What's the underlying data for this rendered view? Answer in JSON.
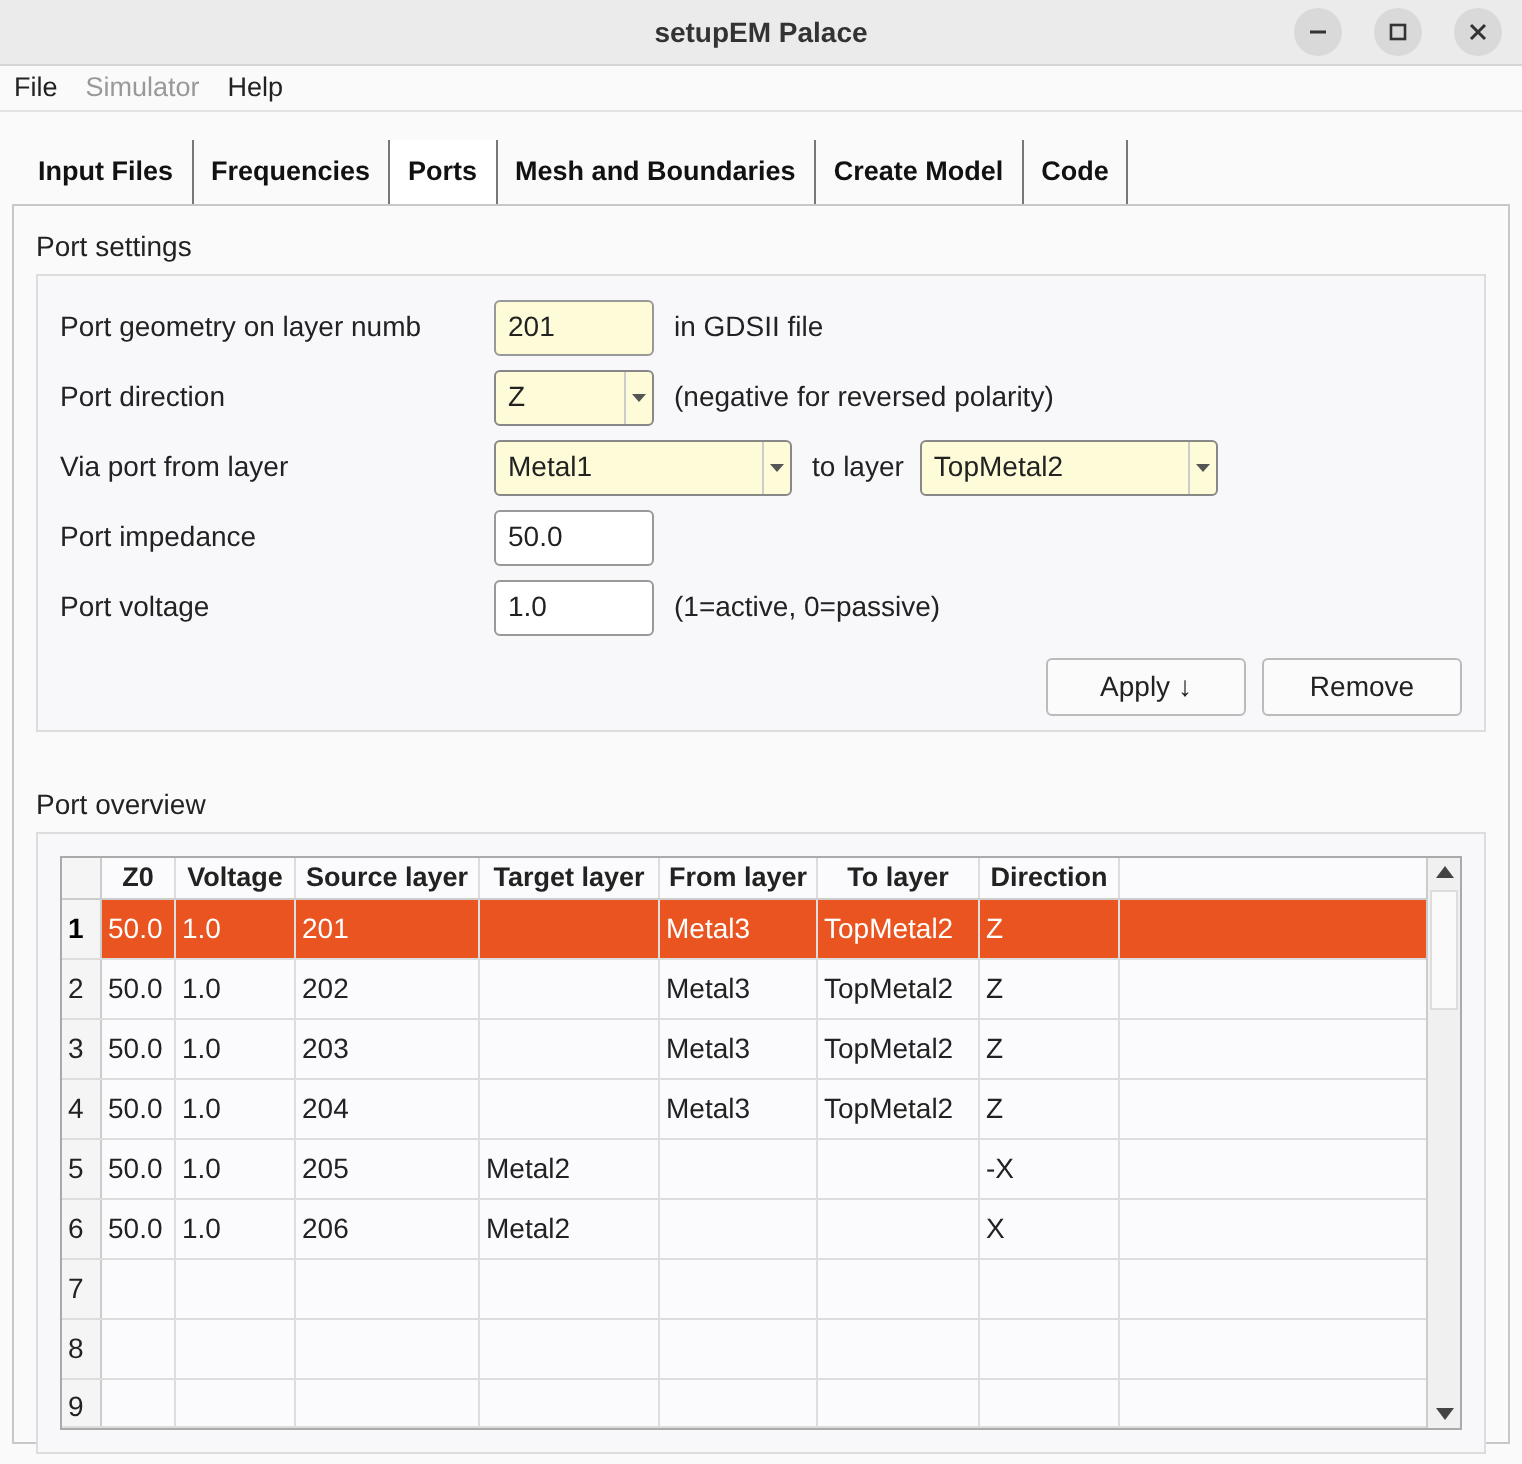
{
  "window": {
    "title": "setupEM Palace"
  },
  "menu": [
    {
      "label": "File",
      "disabled": false
    },
    {
      "label": "Simulator",
      "disabled": true
    },
    {
      "label": "Help",
      "disabled": false
    }
  ],
  "tabs": [
    {
      "label": "Input Files",
      "selected": false
    },
    {
      "label": "Frequencies",
      "selected": false
    },
    {
      "label": "Ports",
      "selected": true
    },
    {
      "label": "Mesh and Boundaries",
      "selected": false
    },
    {
      "label": "Create Model",
      "selected": false
    },
    {
      "label": "Code",
      "selected": false
    }
  ],
  "port_settings": {
    "title": "Port settings",
    "rows": [
      {
        "label": "Port geometry on layer numb",
        "controls": [
          {
            "kind": "field",
            "value": "201",
            "highlighted": true
          }
        ],
        "note": "in GDSII file"
      },
      {
        "label": "Port direction",
        "controls": [
          {
            "kind": "combo",
            "value": "Z",
            "highlighted": true
          }
        ],
        "note": "(negative for reversed polarity)"
      },
      {
        "label": "Via port from layer",
        "controls": [
          {
            "kind": "long_combo",
            "value": "Metal1",
            "highlighted": true
          },
          {
            "kind": "text",
            "value": "to layer"
          },
          {
            "kind": "long_combo",
            "value": "TopMetal2",
            "highlighted": true
          }
        ]
      },
      {
        "label": "Port impedance",
        "controls": [
          {
            "kind": "field",
            "value": "50.0",
            "highlighted": false
          }
        ]
      },
      {
        "label": "Port voltage",
        "controls": [
          {
            "kind": "field",
            "value": "1.0",
            "highlighted": false
          }
        ],
        "note": "(1=active, 0=passive)"
      }
    ],
    "buttons": [
      "Apply ↓",
      "Remove"
    ]
  },
  "port_overview": {
    "title": "Port overview",
    "columns": [
      "Z0",
      "Voltage",
      "Source layer",
      "Target layer",
      "From layer",
      "To layer",
      "Direction"
    ],
    "rows": [
      {
        "header": "1",
        "selected": true,
        "cells": [
          "50.0",
          "1.0",
          "201",
          null,
          "Metal3",
          "TopMetal2",
          "Z"
        ]
      },
      {
        "header": "2",
        "selected": false,
        "cells": [
          "50.0",
          "1.0",
          "202",
          null,
          "Metal3",
          "TopMetal2",
          "Z"
        ]
      },
      {
        "header": "3",
        "selected": false,
        "cells": [
          "50.0",
          "1.0",
          "203",
          null,
          "Metal3",
          "TopMetal2",
          "Z"
        ]
      },
      {
        "header": "4",
        "selected": false,
        "cells": [
          "50.0",
          "1.0",
          "204",
          null,
          "Metal3",
          "TopMetal2",
          "Z"
        ]
      },
      {
        "header": "5",
        "selected": false,
        "cells": [
          "50.0",
          "1.0",
          "205",
          "Metal2",
          null,
          null,
          "-X"
        ]
      },
      {
        "header": "6",
        "selected": false,
        "cells": [
          "50.0",
          "1.0",
          "206",
          "Metal2",
          null,
          null,
          "X"
        ]
      },
      {
        "header": "7",
        "selected": false
      },
      {
        "header": "8",
        "selected": false
      },
      {
        "header": "9",
        "selected": false
      }
    ]
  }
}
